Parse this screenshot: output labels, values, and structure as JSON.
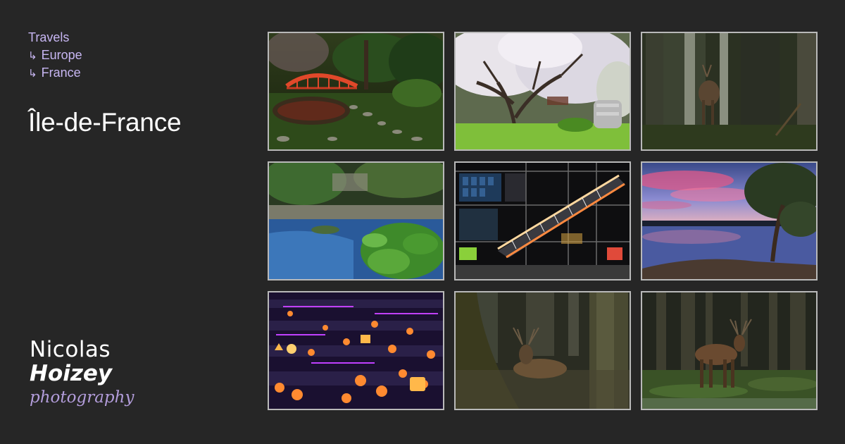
{
  "breadcrumb": {
    "items": [
      {
        "label": "Travels"
      },
      {
        "label": "Europe",
        "arrow": "↳"
      },
      {
        "label": "France",
        "arrow": "↳"
      }
    ]
  },
  "page_title": "Île-de-France",
  "logo": {
    "line1": "Nicolas",
    "line2": "Hoizey",
    "line3": "photography"
  },
  "gallery": {
    "photos": [
      {
        "subject": "japanese-garden-red-bridge"
      },
      {
        "subject": "cherry-blossom-tree"
      },
      {
        "subject": "deer-in-forest"
      },
      {
        "subject": "garden-pond-water-lilies"
      },
      {
        "subject": "building-escalator-night"
      },
      {
        "subject": "lake-sunset-pink-clouds"
      },
      {
        "subject": "neon-maze-installation"
      },
      {
        "subject": "stag-lying-in-forest"
      },
      {
        "subject": "stag-standing-in-forest"
      }
    ]
  }
}
